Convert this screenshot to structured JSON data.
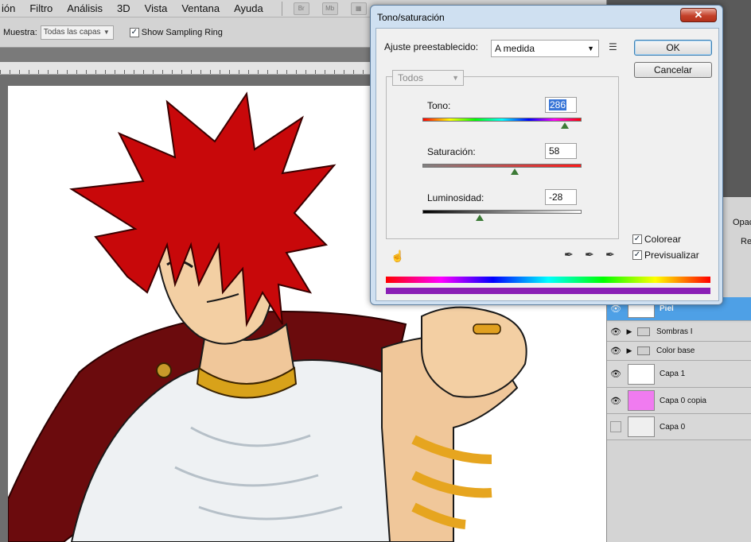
{
  "menu": [
    "ión",
    "Filtro",
    "Análisis",
    "3D",
    "Vista",
    "Ventana",
    "Ayuda"
  ],
  "toolbar_icons": [
    "Br",
    "Mb"
  ],
  "options": {
    "sample_label": "Muestra:",
    "sample_value": "Todas las capas",
    "ring_label": "Show Sampling Ring",
    "ring_checked": true
  },
  "layers": {
    "header": "Opac",
    "header2": "Rell",
    "rows": [
      {
        "name": "Piel",
        "selected": true,
        "kind": "layer"
      },
      {
        "name": "Sombras I",
        "kind": "folder"
      },
      {
        "name": "Color base",
        "kind": "folder"
      },
      {
        "name": "Capa 1",
        "kind": "layer"
      },
      {
        "name": "Capa 0 copia",
        "kind": "layer"
      },
      {
        "name": "Capa 0",
        "kind": "layer"
      }
    ]
  },
  "dialog": {
    "title": "Tono/saturación",
    "close": "✕",
    "preset_label": "Ajuste preestablecido:",
    "preset_value": "A medida",
    "ok": "OK",
    "cancel": "Cancelar",
    "range": "Todos",
    "hue_label": "Tono:",
    "hue_value": "286",
    "hue_position": 0.895,
    "sat_label": "Saturación:",
    "sat_value": "58",
    "sat_position": 0.58,
    "lum_label": "Luminosidad:",
    "lum_value": "-28",
    "lum_position": 0.36,
    "colorize_label": "Colorear",
    "colorize_checked": true,
    "preview_label": "Previsualizar",
    "preview_checked": true
  },
  "colors": {
    "selection": "#3875d7",
    "layer_selected": "#4ea0e6",
    "dialog_frame": "#cfe0f1",
    "close_red": "#c4412a",
    "hair_red": "#c8080a",
    "cape": "#6b0b0d"
  }
}
